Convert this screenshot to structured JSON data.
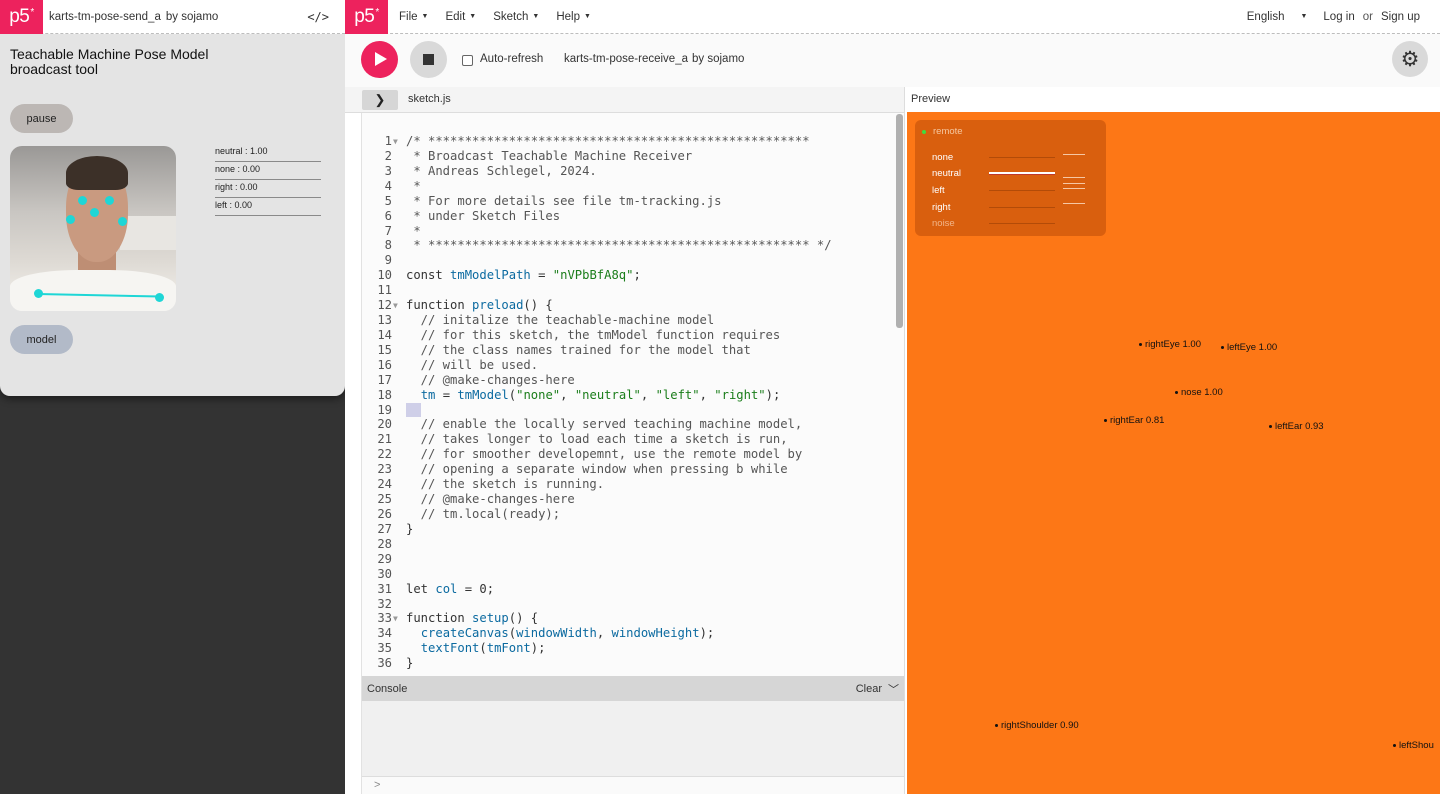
{
  "popup": {
    "logo": "p5",
    "sketch_title": "karts-tm-pose-send_a",
    "by": "by",
    "author": "sojamo",
    "code_icon": "</>",
    "title_line1": "Teachable Machine Pose Model",
    "title_line2": "broadcast tool",
    "pause_label": "pause",
    "model_label": "model",
    "probabilities": [
      "neutral : 1.00",
      "none : 0.00",
      "right : 0.00",
      "left : 0.00"
    ]
  },
  "nav": {
    "logo": "p5",
    "menu": [
      "File",
      "Edit",
      "Sketch",
      "Help"
    ],
    "language": "English",
    "login": "Log in",
    "or": "or",
    "signup": "Sign up"
  },
  "toolbar": {
    "auto_refresh": "Auto-refresh",
    "sketch_name": "karts-tm-pose-receive_a",
    "by": "by",
    "author": "sojamo"
  },
  "editor": {
    "file_tab": "sketch.js",
    "preview_label": "Preview",
    "lines": [
      "/* ****************************************************",
      " * Broadcast Teachable Machine Receiver",
      " * Andreas Schlegel, 2024.",
      " *",
      " * For more details see file tm-tracking.js",
      " * under Sketch Files",
      " *",
      " * **************************************************** */",
      "",
      "const tmModelPath = \"nVPbBfA8q\";",
      "",
      "function preload() {",
      "  // initalize the teachable-machine model",
      "  // for this sketch, the tmModel function requires",
      "  // the class names trained for the model that",
      "  // will be used.",
      "  // @make-changes-here",
      "  tm = tmModel(\"none\", \"neutral\", \"left\", \"right\");",
      "",
      "  // enable the locally served teaching machine model,",
      "  // takes longer to load each time a sketch is run,",
      "  // for smoother developemnt, use the remote model by",
      "  // opening a separate window when pressing b while",
      "  // the sketch is running.",
      "  // @make-changes-here",
      "  // tm.local(ready);",
      "}",
      "",
      "",
      "",
      "let col = 0;",
      "",
      "function setup() {",
      "  createCanvas(windowWidth, windowHeight);",
      "  textFont(tmFont);",
      "}"
    ]
  },
  "console": {
    "label": "Console",
    "clear": "Clear",
    "prompt": ">"
  },
  "preview": {
    "remote_label": "remote",
    "classes": [
      "none",
      "neutral",
      "left",
      "right",
      "noise"
    ],
    "keypoints": [
      {
        "label": "rightEye 1.00"
      },
      {
        "label": "leftEye 1.00"
      },
      {
        "label": "nose 1.00"
      },
      {
        "label": "rightEar 0.81"
      },
      {
        "label": "leftEar 0.93"
      },
      {
        "label": "rightShoulder 0.90"
      },
      {
        "label": "leftShou"
      }
    ]
  },
  "colors": {
    "brand": "#ed225d",
    "preview_bg": "#fd7716",
    "keypoint": "#1ed6d6"
  }
}
